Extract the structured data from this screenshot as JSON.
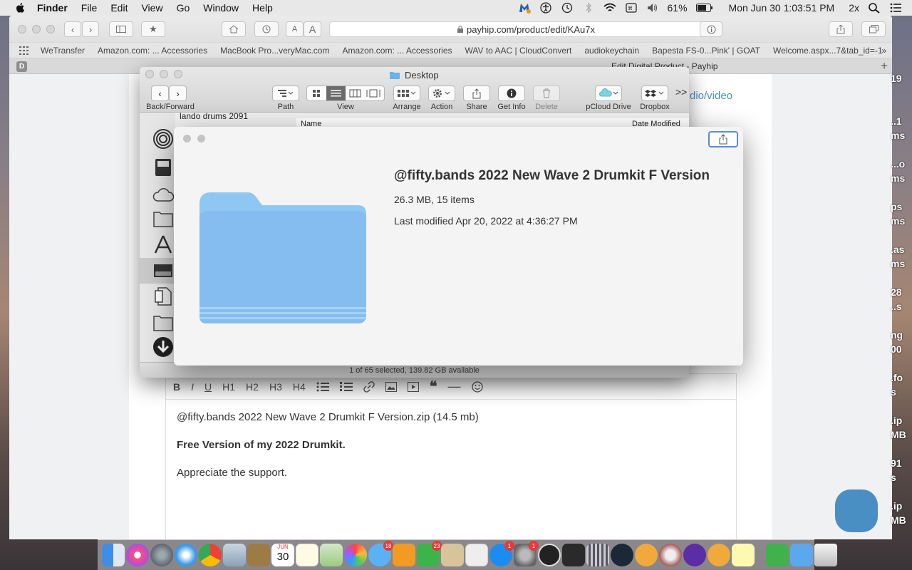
{
  "menubar": {
    "app_name": "Finder",
    "menus": [
      "File",
      "Edit",
      "View",
      "Go",
      "Window",
      "Help"
    ],
    "battery": "61%",
    "datetime": "Mon Jun 30  1:03:51 PM",
    "zoom": "2x"
  },
  "safari": {
    "address": "payhip.com/product/edit/KAu7x",
    "bookmarks": [
      "WeTransfer",
      "Amazon.com: ... Accessories",
      "MacBook Pro...veryMac.com",
      "Amazon.com: ... Accessories",
      "WAV to AAC | CloudConvert",
      "audiokeychain",
      "Bapesta FS-0...Pink' | GOAT",
      "Welcome.aspx...7&tab_id=-1"
    ],
    "tab_badge": "D",
    "tab_title": "Edit Digital Product - Payhip",
    "font_small": "A",
    "font_large": "A"
  },
  "page": {
    "audio_link": "dio/video",
    "editor_toolbar": [
      "B",
      "I",
      "U",
      "H1",
      "H2",
      "H3",
      "H4"
    ],
    "editor_lines": [
      "@fifty.bands 2022 New Wave 2 Drumkit F Version.zip (14.5 mb)",
      "Free Version of my 2022 Drumkit.",
      "Appreciate the support."
    ]
  },
  "finder": {
    "title": "Desktop",
    "toolbar_labels": {
      "back_forward": "Back/Forward",
      "path": "Path",
      "view": "View",
      "arrange": "Arrange",
      "action": "Action",
      "share": "Share",
      "get_info": "Get Info",
      "delete": "Delete",
      "pcloud": "pCloud Drive",
      "dropbox": "Dropbox",
      "overflow": ">>"
    },
    "partial_item": "lando drums 2091",
    "col_name": "Name",
    "col_date": "Date Modified",
    "status": "1 of 65 selected, 139.82 GB available"
  },
  "quicklook": {
    "name": "@fifty.bands 2022 New Wave 2 Drumkit F Version",
    "size": "26.3 MB, 15 items",
    "modified": "Last modified Apr 20, 2022 at 4:36:27 PM"
  },
  "right_strip": [
    "19",
    "..1\nms",
    "...o\nms",
    "ps\nms",
    ".as\nms",
    "28\n..s",
    "ng\n00",
    ".fo\ns",
    ".ip\nMB",
    "91\ns",
    ".ip\nMB"
  ],
  "dock": {
    "calendar_month": "JUN",
    "calendar_day": "30",
    "badges": {
      "messages": "18",
      "facetime": "23",
      "appstore": "1",
      "sysprefs": "1"
    }
  }
}
